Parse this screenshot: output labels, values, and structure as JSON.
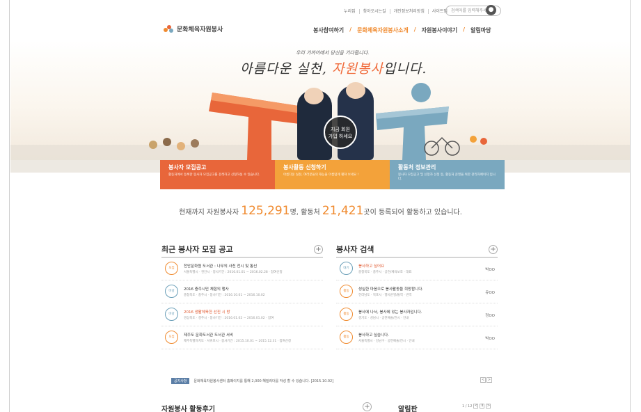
{
  "utility": {
    "links": [
      "누리집",
      "찾아오시는길",
      "개인정보처리방침",
      "사이트맵"
    ],
    "search_placeholder": "검색어를 입력해주세요"
  },
  "logo": {
    "text": "문화체육자원봉사"
  },
  "nav": {
    "items": [
      "봉사참여하기",
      "문화체육자원봉사소개",
      "자원봉사이야기",
      "알림마당"
    ],
    "active_index": 1,
    "separator": "/"
  },
  "hero": {
    "subtitle": "우리 가까이에서 당신을 기다립니다.",
    "title_pre": "아름다운 실천, ",
    "title_em": "자원봉사",
    "title_post": "입니다.",
    "join_line1": "지금 회원",
    "join_line2": "가입 하세요"
  },
  "boxes": [
    {
      "title": "봉사자 모집공고",
      "desc": "활동처에서 등록한 봉사자 모집공고를 검색하고 신청하실 수 있습니다.",
      "color": "#e8663a"
    },
    {
      "title": "봉사활동 신청하기",
      "desc": "아름다운 실천, 여러분들의 재능을 아름답게 펼쳐 보세요 !",
      "color": "#f3a23a"
    },
    {
      "title": "활동처 정보관리",
      "desc": "봉사자 모집공고 및 신청자 선정 등, 활동처 운영을 위한 관리자페이지 입니다.",
      "color": "#7aa8bf"
    }
  ],
  "stats": {
    "prefix": "현재까지 자원봉사자 ",
    "volunteers": "125,291",
    "mid": "명, 활동처 ",
    "orgs": "21,421",
    "suffix": "곳이 등록되어 활동하고 있습니다."
  },
  "recruit": {
    "title": "최근 봉사자 모집 공고",
    "plus": "+",
    "rows": [
      {
        "badge": "모집",
        "badge_color": "o",
        "title": "천안문화원 도서관 : 나무의 사진 전시 및 통신",
        "sub": "서울특별시 · 천안시 · 봉사기간 : 2016.01.01 ~ 2016.02.28 · 참여신청",
        "hl": false
      },
      {
        "badge": "마감",
        "badge_color": "b",
        "title": "2016 충주시민 체험의 행사",
        "sub": "충청북도 · 충주시 · 봉사기간 : 2016.10.01 ~ 2016.10.02",
        "hl": false
      },
      {
        "badge": "마감",
        "badge_color": "b",
        "title": "2016 생활체육한 선진 시 방",
        "sub": "경상북도 · 경주시 · 봉사기간 : 2016.01.02 ~ 2016.01.02 · 참여",
        "hl": true
      },
      {
        "badge": "모집",
        "badge_color": "o",
        "title": "제주도 문화도서관 도서관 서비",
        "sub": "제주특별자치도 · 서귀포시 · 봉사기간 : 2015.10.01 ~ 2015.12.31 · 참여신청",
        "hl": false
      }
    ]
  },
  "volunteer_search": {
    "title": "봉사자 검색",
    "plus": "+",
    "rows": [
      {
        "badge": "대기",
        "badge_color": "b",
        "title": "봉사하고 싶어요",
        "sub": "충청북도 · 충주시 · 공연/체육보조 · 대표",
        "name": "박OO",
        "hl": true
      },
      {
        "badge": "활동",
        "badge_color": "o",
        "title": "성실한 마음으로 봉사활동을 희망합니다.",
        "sub": "전라남도 · 목포시 · 행사운영/통역 · 번역",
        "name": "유OO",
        "hl": false
      },
      {
        "badge": "활동",
        "badge_color": "o",
        "title": "봉사에 나서, 봉사에 있는 봉사자입니다.",
        "sub": "경기도 · 성남시 · 공연예술/전시 · 안내",
        "name": "정OO",
        "hl": false
      },
      {
        "badge": "활동",
        "badge_color": "o",
        "title": "봉사하고 싶습니다.",
        "sub": "서울특별시 · 강남구 · 공연예술/전시 · 안내",
        "name": "박OO",
        "hl": false
      }
    ]
  },
  "notice": {
    "tag": "공지사항",
    "text": "문화체육자원봉사센터 홈페이지를 통해 2,000 해밀리더를 작성 할 수 있습니다. [2015.10.02]",
    "prev": "<",
    "next": ">"
  },
  "bottom": {
    "review_title": "자원봉사 활동후기",
    "review_plus": "+",
    "board_title": "알림판",
    "pager_text": "1 / 12",
    "pager_prev": "<",
    "pager_pause": "II",
    "pager_next": ">"
  },
  "colors": {
    "accent": "#f08a2e",
    "orange_box": "#e8663a",
    "yellow_box": "#f3a23a",
    "blue_box": "#7aa8bf"
  }
}
